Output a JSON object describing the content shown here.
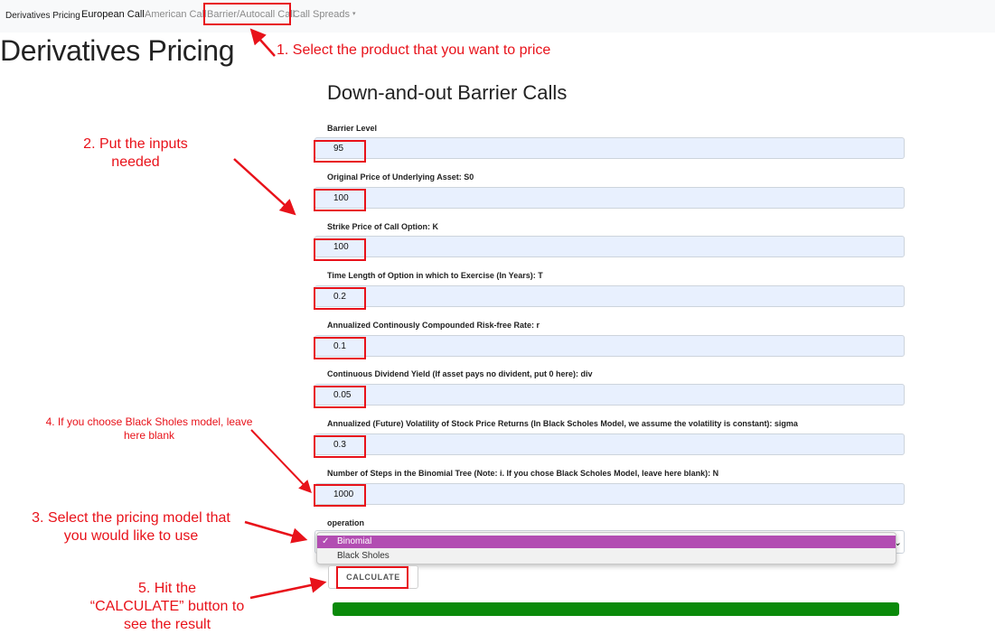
{
  "navbar": {
    "brand": "Derivatives Pricing",
    "links": [
      "European Call",
      "American Call",
      "Barrier/Autocall Call",
      "Call Spreads"
    ],
    "dropdown_caret": "▾"
  },
  "page_title": "Derivatives Pricing",
  "form": {
    "title": "Down-and-out Barrier Calls",
    "fields": [
      {
        "label": "Barrier Level",
        "value": "95"
      },
      {
        "label": "Original Price of Underlying Asset: S0",
        "value": "100"
      },
      {
        "label": "Strike Price of Call Option: K",
        "value": "100"
      },
      {
        "label": "Time Length of Option in which to Exercise (In Years): T",
        "value": "0.2"
      },
      {
        "label": "Annualized Continously Compounded Risk-free Rate: r",
        "value": "0.1"
      },
      {
        "label": "Continuous Dividend Yield (If asset pays no divident, put 0 here): div",
        "value": "0.05"
      },
      {
        "label": "Annualized (Future) Volatility of Stock Price Returns (In Black Scholes Model, we assume the volatility is constant): sigma",
        "value": "0.3"
      },
      {
        "label": "Number of Steps in the Binomial Tree (Note: i. If you chose Black Scholes Model, leave here blank): N",
        "value": "1000"
      }
    ],
    "operation": {
      "label": "operation",
      "options": [
        "Binomial",
        "Black Sholes"
      ],
      "selected": "Binomial",
      "check": "✓",
      "arrow": "⌄"
    },
    "calculate_label": "CALCULATE"
  },
  "progress": {
    "percent": 100,
    "color": "#0a8a0a"
  },
  "annotations": {
    "step1": "1. Select the product that you want to price",
    "step2_line1": "2. Put the inputs",
    "step2_line2": "needed",
    "step3_line1": "3. Select the pricing model that",
    "step3_line2": "you would like to use",
    "step4_line1": "4. If you choose Black Sholes model, leave",
    "step4_line2": "here blank",
    "step5_line1": "5. Hit the",
    "step5_line2": "“CALCULATE” button to",
    "step5_line3": "see the result",
    "color": "#e8121a"
  }
}
